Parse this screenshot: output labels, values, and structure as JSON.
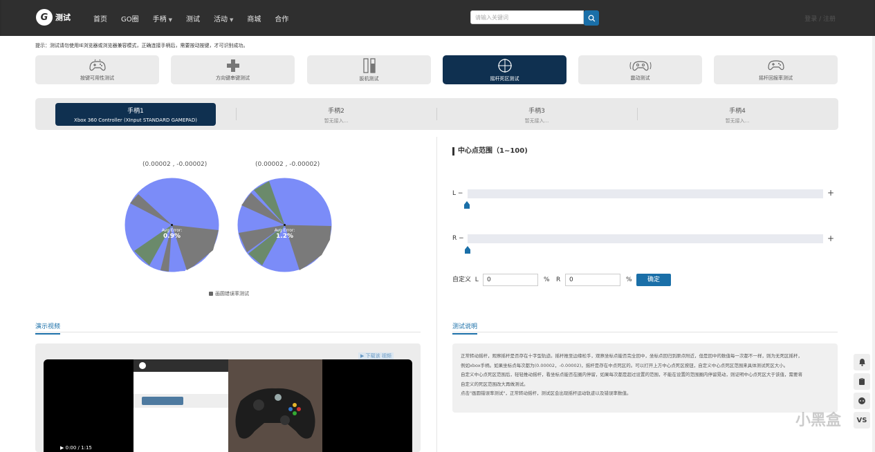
{
  "header": {
    "logo_text": "测试",
    "logo_badge": "G",
    "nav": [
      {
        "label": "首页",
        "dropdown": false
      },
      {
        "label": "GO圈",
        "dropdown": false
      },
      {
        "label": "手柄",
        "dropdown": true
      },
      {
        "label": "测试",
        "dropdown": false
      },
      {
        "label": "活动",
        "dropdown": true
      },
      {
        "label": "商城",
        "dropdown": false
      },
      {
        "label": "合作",
        "dropdown": false
      }
    ],
    "search_placeholder": "请输入关键词",
    "user_text": "登录 / 注册"
  },
  "tip": "提示：测试请勿使用IE浏览器或浏览器兼容模式，正确连接手柄后，需要按动按键，才可识别成功。",
  "modes": [
    {
      "label": "按键可用性测试",
      "icon": "gamepad-outline-icon",
      "active": false
    },
    {
      "label": "方向键串键测试",
      "icon": "dpad-icon",
      "active": false
    },
    {
      "label": "扳机测试",
      "icon": "trigger-bars-icon",
      "active": false
    },
    {
      "label": "摇杆死区测试",
      "icon": "crosshair-icon",
      "active": true
    },
    {
      "label": "震动测试",
      "icon": "vibration-gamepad-icon",
      "active": false
    },
    {
      "label": "摇杆回报率测试",
      "icon": "gamepad-icon",
      "active": false
    }
  ],
  "pads": [
    {
      "title": "手柄1",
      "sub": "Xbox 360 Controller (XInput STANDARD GAMEPAD)",
      "active": true
    },
    {
      "title": "手柄2",
      "sub": "暂无接入...",
      "active": false
    },
    {
      "title": "手柄3",
      "sub": "暂无接入...",
      "active": false
    },
    {
      "title": "手柄4",
      "sub": "暂无接入...",
      "active": false
    }
  ],
  "sticks": [
    {
      "coord": "(0.00002 , -0.00002)",
      "avg_label": "Avg Error:",
      "avg_value": "0.9%"
    },
    {
      "coord": "(0.00002 , -0.00002)",
      "avg_label": "Avg Error:",
      "avg_value": "1.2%"
    }
  ],
  "checkbox_label": "画圆错误率测试",
  "demo_video": {
    "title": "演示视频",
    "hint": "▶ 下载该 视频",
    "time": "0:00 / 1:15"
  },
  "center_range": {
    "title": "中心点范围（1~100)",
    "left_label": "L",
    "right_label": "R",
    "minus": "−",
    "plus": "+",
    "left_value": 0,
    "right_value": 0,
    "custom_label": "自定义",
    "custom_l_label": "L",
    "custom_r_label": "R",
    "custom_l_value": "0",
    "custom_r_value": "0",
    "percent": "%",
    "confirm": "确定"
  },
  "description": {
    "title": "测试说明",
    "lines": [
      "正常转动摇杆，观察摇杆是否存在十字型轨迹。摇杆推至边缘松手，观察坐标点能否完全回中，坐标点回归到原点附近，但是回中的数值每一次都不一样，则为无死区摇杆，",
      "例如xbox手柄。如果坐标点每次都为(0.00002，-0.00002)，摇杆是存在中点死区的。可以打开上方中心点死区按钮，自定义中心点死区范围来具体测试死区大小。",
      "自定义中心点死区范围后，轻轻推动摇杆，看坐标点能否在圈内停留，如果每次都是超过设置的范围，不能在设置的范围圈内停留晃动，则证明中心点死区大于该值，需要将",
      "自定义的死区范围改大再做测试。",
      "点击\"画圆错误率测试\"，正常转动摇杆，测试区会出现摇杆运动轨迹以及错误率数值。"
    ]
  },
  "side_buttons": [
    "bell-icon",
    "clipboard-icon",
    "chat-icon",
    "vs-icon"
  ],
  "side_vs_text": "VS",
  "watermark": "小黑盒",
  "colors": {
    "accent": "#1a6fa8",
    "active_dark": "#0f3050",
    "pie_blue": "#7b8cf8",
    "pie_gray": "#7a7a7a",
    "pie_green": "#6b8a6b"
  }
}
